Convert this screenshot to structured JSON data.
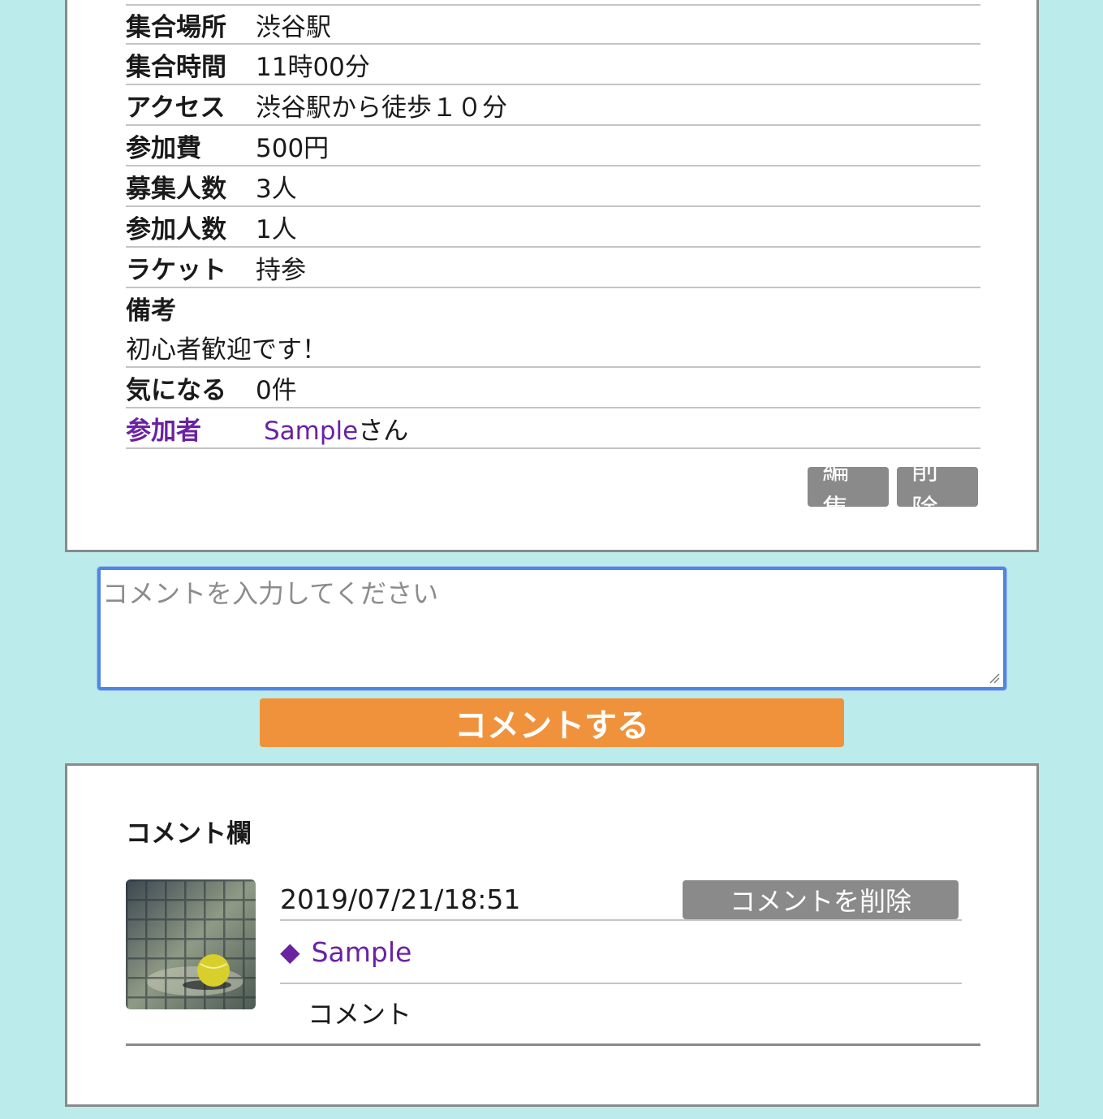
{
  "details": [
    {
      "label": "集合場所",
      "value": "渋谷駅"
    },
    {
      "label": "集合時間",
      "value": "11時00分"
    },
    {
      "label": "アクセス",
      "value": "渋谷駅から徒歩１０分"
    },
    {
      "label": "参加費",
      "value": "500円"
    },
    {
      "label": "募集人数",
      "value": "3人"
    },
    {
      "label": "参加人数",
      "value": "1人"
    },
    {
      "label": "ラケット",
      "value": "持参"
    }
  ],
  "note": {
    "label": "備考",
    "value": "初心者歓迎です！"
  },
  "interest": {
    "label": "気になる",
    "value": "0件"
  },
  "participants": {
    "label": "参加者",
    "name": "Sample",
    "suffix": "さん"
  },
  "actions": {
    "edit": "編集",
    "delete": "削除"
  },
  "comment_form": {
    "placeholder": "コメントを入力してください",
    "submit": "コメントする"
  },
  "comments": {
    "title": "コメント欄",
    "items": [
      {
        "date": "2019/07/21/18:51",
        "delete": "コメントを削除",
        "user": "Sample",
        "text": "コメント"
      }
    ]
  },
  "colors": {
    "background": "#bbebeb",
    "accent": "#f0923c",
    "link": "#6a22a3",
    "button": "#8a8a8a"
  }
}
